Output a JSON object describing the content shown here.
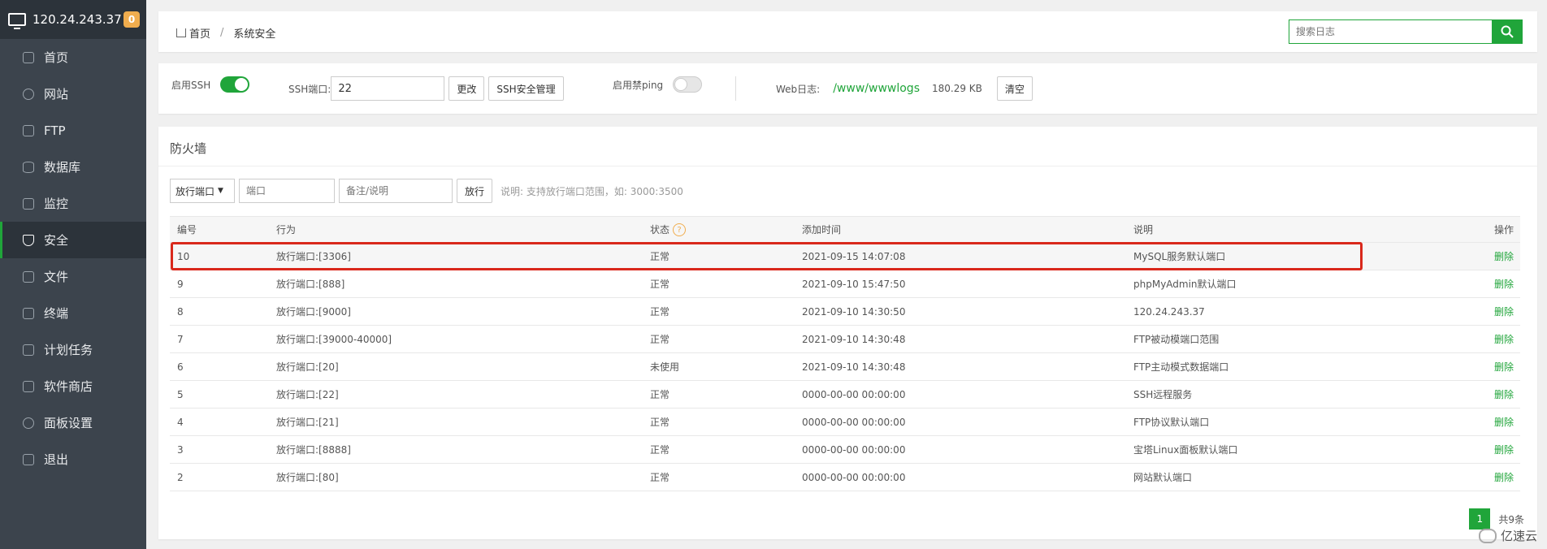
{
  "sidebar": {
    "server_ip": "120.24.243.37",
    "badge": "0",
    "items": [
      {
        "label": "首页",
        "icon": "home-icon"
      },
      {
        "label": "网站",
        "icon": "globe-icon"
      },
      {
        "label": "FTP",
        "icon": "ftp-icon"
      },
      {
        "label": "数据库",
        "icon": "database-icon"
      },
      {
        "label": "监控",
        "icon": "monitor-icon"
      },
      {
        "label": "安全",
        "icon": "shield-icon",
        "active": true
      },
      {
        "label": "文件",
        "icon": "folder-icon"
      },
      {
        "label": "终端",
        "icon": "terminal-icon"
      },
      {
        "label": "计划任务",
        "icon": "clock-icon"
      },
      {
        "label": "软件商店",
        "icon": "apps-icon"
      },
      {
        "label": "面板设置",
        "icon": "gear-icon"
      },
      {
        "label": "退出",
        "icon": "logout-icon"
      }
    ]
  },
  "breadcrumb": {
    "home": "首页",
    "sep": "/",
    "current": "系统安全"
  },
  "search": {
    "placeholder": "搜索日志"
  },
  "ssh": {
    "enable_label": "启用SSH",
    "port_label": "SSH端口:",
    "port_value": "22",
    "change_button": "更改",
    "manage_button": "SSH安全管理",
    "ping_label": "启用禁ping",
    "weblog_label": "Web日志:",
    "weblog_path": "/www/wwwlogs",
    "weblog_size": "180.29 KB",
    "clear_button": "清空"
  },
  "firewall": {
    "title": "防火墙",
    "select_value": "放行端口",
    "port_placeholder": "端口",
    "note_placeholder": "备注/说明",
    "allow_button": "放行",
    "hint": "说明: 支持放行端口范围，如: 3000:3500",
    "columns": [
      "编号",
      "行为",
      "状态",
      "添加时间",
      "说明",
      "操作"
    ],
    "rows": [
      {
        "id": "10",
        "action": "放行端口:[3306]",
        "status": "正常",
        "time": "2021-09-15 14:07:08",
        "note": "MySQL服务默认端口",
        "op": "删除"
      },
      {
        "id": "9",
        "action": "放行端口:[888]",
        "status": "正常",
        "time": "2021-09-10 15:47:50",
        "note": "phpMyAdmin默认端口",
        "op": "删除"
      },
      {
        "id": "8",
        "action": "放行端口:[9000]",
        "status": "正常",
        "time": "2021-09-10 14:30:50",
        "note": "120.24.243.37",
        "op": "删除"
      },
      {
        "id": "7",
        "action": "放行端口:[39000-40000]",
        "status": "正常",
        "time": "2021-09-10 14:30:48",
        "note": "FTP被动模端口范围",
        "op": "删除"
      },
      {
        "id": "6",
        "action": "放行端口:[20]",
        "status": "未使用",
        "time": "2021-09-10 14:30:48",
        "note": "FTP主动模式数据端口",
        "op": "删除"
      },
      {
        "id": "5",
        "action": "放行端口:[22]",
        "status": "正常",
        "time": "0000-00-00 00:00:00",
        "note": "SSH远程服务",
        "op": "删除"
      },
      {
        "id": "4",
        "action": "放行端口:[21]",
        "status": "正常",
        "time": "0000-00-00 00:00:00",
        "note": "FTP协议默认端口",
        "op": "删除"
      },
      {
        "id": "3",
        "action": "放行端口:[8888]",
        "status": "正常",
        "time": "0000-00-00 00:00:00",
        "note": "宝塔Linux面板默认端口",
        "op": "删除"
      },
      {
        "id": "2",
        "action": "放行端口:[80]",
        "status": "正常",
        "time": "0000-00-00 00:00:00",
        "note": "网站默认端口",
        "op": "删除"
      }
    ],
    "page": "1",
    "total": "共9条"
  },
  "watermark": "亿速云",
  "colors": {
    "accent": "#20a53a",
    "sidebar": "#3c444d",
    "highlight": "#d9281b"
  }
}
